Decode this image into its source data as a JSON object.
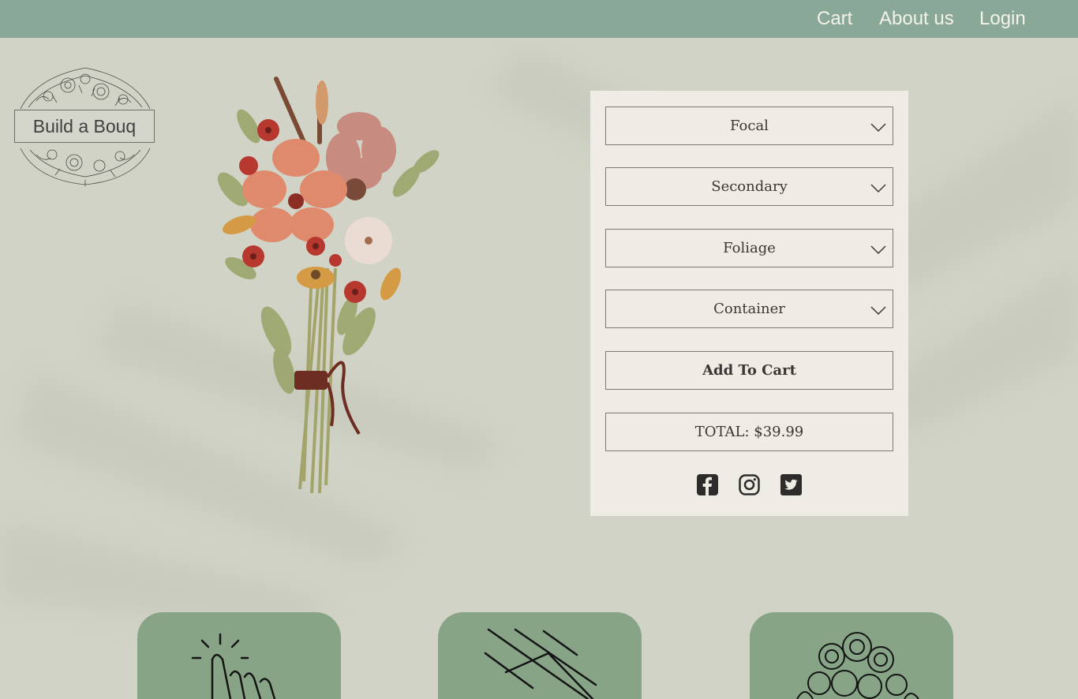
{
  "nav": {
    "cart": "Cart",
    "about": "About us",
    "login": "Login"
  },
  "logo": {
    "text": "Build a Bouq"
  },
  "form": {
    "focal": "Focal",
    "secondary": "Secondary",
    "foliage": "Foliage",
    "container": "Container",
    "add_to_cart": "Add To Cart",
    "total": "TOTAL: $39.99"
  },
  "social": [
    "facebook-icon",
    "instagram-icon",
    "twitter-icon"
  ],
  "cards": [
    "pointer-click-icon",
    "ribbon-lines-icon",
    "flower-bunch-icon"
  ],
  "colors": {
    "topbar": "#8aa898",
    "background": "#d0d3c5",
    "panel": "#efebe5",
    "card": "#87a586"
  }
}
